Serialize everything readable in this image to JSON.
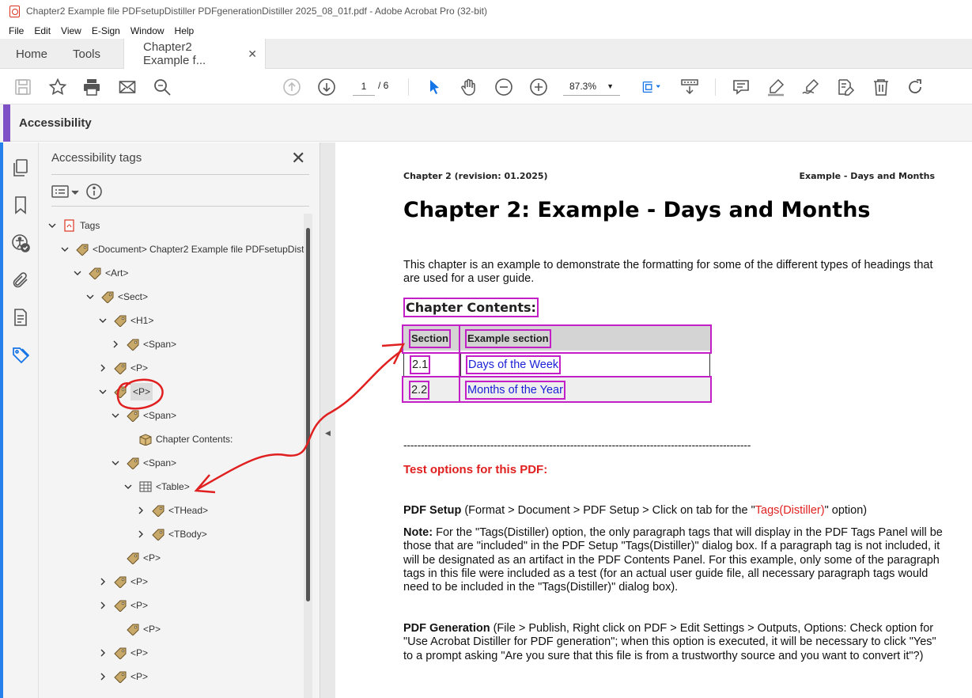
{
  "window": {
    "title": "Chapter2 Example file PDFsetupDistiller PDFgenerationDistiller 2025_08_01f.pdf - Adobe Acrobat Pro (32-bit)"
  },
  "menu": [
    "File",
    "Edit",
    "View",
    "E-Sign",
    "Window",
    "Help"
  ],
  "tabs": {
    "home": "Home",
    "tools": "Tools",
    "document": "Chapter2 Example f...",
    "close_glyph": "✕"
  },
  "toolbar": {
    "page_current": "1",
    "page_total": "/ 6",
    "zoom": "87.3%",
    "icons": [
      "save-icon",
      "star-icon",
      "print-icon",
      "mail-icon",
      "search-icon",
      "page-up-icon",
      "page-down-icon",
      "select-arrow-icon",
      "hand-icon",
      "zoom-out-icon",
      "zoom-in-icon",
      "fit-page-icon",
      "scroll-mode-icon",
      "comment-icon",
      "highlight-icon",
      "sign-icon",
      "redact-icon",
      "delete-icon",
      "redo-icon"
    ]
  },
  "panel_header": {
    "title": "Accessibility"
  },
  "left_rail": {
    "icons": [
      "pages-icon",
      "bookmark-icon",
      "accessibility-check-icon",
      "attachment-icon",
      "content-icon",
      "tag-icon"
    ]
  },
  "tags_panel": {
    "title": "Accessibility tags",
    "close": "✕",
    "tree": [
      {
        "label": "Tags",
        "level": 0,
        "expanded": true,
        "icon": "pdf-icon"
      },
      {
        "label": "<Document> Chapter2 Example file PDFsetupDist",
        "level": 1,
        "expanded": true,
        "icon": "tag-icon"
      },
      {
        "label": "<Art>",
        "level": 2,
        "expanded": true,
        "icon": "tag-icon"
      },
      {
        "label": "<Sect>",
        "level": 3,
        "expanded": true,
        "icon": "tag-icon"
      },
      {
        "label": "<H1>",
        "level": 4,
        "expanded": true,
        "icon": "tag-icon"
      },
      {
        "label": "<Span>",
        "level": 5,
        "expanded": false,
        "icon": "tag-icon"
      },
      {
        "label": "<P>",
        "level": 4,
        "expanded": false,
        "icon": "tag-icon"
      },
      {
        "label": "<P>",
        "level": 4,
        "expanded": true,
        "icon": "tag-icon",
        "selected": true
      },
      {
        "label": "<Span>",
        "level": 5,
        "expanded": true,
        "icon": "tag-icon"
      },
      {
        "label": "Chapter Contents:",
        "level": 6,
        "expanded": null,
        "icon": "content-box-icon"
      },
      {
        "label": "<Span>",
        "level": 5,
        "expanded": true,
        "icon": "tag-icon"
      },
      {
        "label": "<Table>",
        "level": 6,
        "expanded": true,
        "icon": "table-icon"
      },
      {
        "label": "<THead>",
        "level": 7,
        "expanded": false,
        "icon": "tag-icon"
      },
      {
        "label": "<TBody>",
        "level": 7,
        "expanded": false,
        "icon": "tag-icon"
      },
      {
        "label": "<P>",
        "level": 5,
        "expanded": null,
        "icon": "tag-icon"
      },
      {
        "label": "<P>",
        "level": 4,
        "expanded": false,
        "icon": "tag-icon"
      },
      {
        "label": "<P>",
        "level": 4,
        "expanded": false,
        "icon": "tag-icon"
      },
      {
        "label": "<P>",
        "level": 5,
        "expanded": null,
        "icon": "tag-icon"
      },
      {
        "label": "<P>",
        "level": 4,
        "expanded": false,
        "icon": "tag-icon"
      },
      {
        "label": "<P>",
        "level": 4,
        "expanded": false,
        "icon": "tag-icon"
      }
    ]
  },
  "document": {
    "header_left": "Chapter 2 (revision: 01.2025)",
    "header_right": "Example - Days and Months",
    "heading": "Chapter 2: Example - Days and Months",
    "intro": "This chapter is an example to demonstrate the formatting for some of the different types of headings that are used for a user guide.",
    "contents_heading": "Chapter Contents:",
    "table": {
      "headers": [
        "Section",
        "Example section"
      ],
      "rows": [
        [
          "2.1",
          "Days of the Week"
        ],
        [
          "2.2",
          "Months of the Year"
        ]
      ]
    },
    "divider": "----------------------------------------------------------------------------------------------------",
    "test_heading": "Test options for this PDF:",
    "pdf_setup": {
      "label": "PDF Setup",
      "text_before": " (Format > Document > PDF Setup > Click on tab for the \"",
      "highlight": "Tags(Distiller)",
      "text_after": "\" option)"
    },
    "note": {
      "label": "Note:",
      "text": " For the \"Tags(Distiller) option, the only paragraph tags that will display in the PDF Tags Panel will be those that are \"included\" in the PDF Setup \"Tags(Distiller)\" dialog box. If a paragraph tag is not included, it will be designated as an artifact in the PDF Contents Panel. For this example, only some of the paragraph tags in this file were included as a test (for an actual user guide file, all necessary paragraph tags would need to be included in the \"Tags(Distiller)\" dialog box)."
    },
    "pdf_generation": {
      "label": "PDF Generation",
      "text": " (File > Publish, Right click on PDF > Edit Settings > Outputs, Options: Check option for \"Use Acrobat Distiller for PDF generation\"; when this option is executed, it will be necessary to click \"Yes\" to a prompt asking \"Are you sure that this file is from a trustworthy source and you want to convert it\"?)"
    }
  },
  "colors": {
    "tag_highlight_box": "#c21fc6",
    "annotation_red": "#e02020",
    "link_blue": "#1a1fd6",
    "accent_purple": "#7e51c6",
    "rail_blue": "#2680eb"
  }
}
